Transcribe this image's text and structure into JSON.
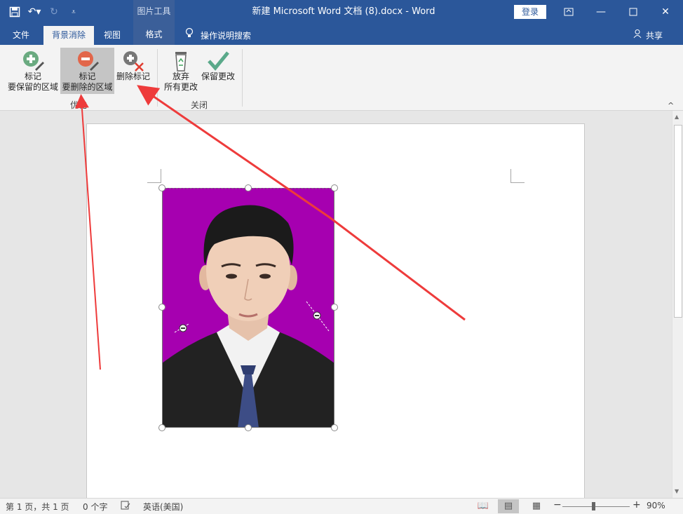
{
  "titlebar": {
    "context_group": "图片工具",
    "doc_title": "新建 Microsoft Word 文档 (8).docx  -  Word",
    "login": "登录",
    "icons": [
      "save-icon",
      "undo-icon",
      "redo-icon",
      "customize-qat-icon",
      "ribbon-display-icon",
      "minimize-icon",
      "maximize-icon",
      "close-icon"
    ]
  },
  "tabs": {
    "file": "文件",
    "bg_removal": "背景消除",
    "view": "视图",
    "format": "格式",
    "search": "操作说明搜索",
    "share": "共享"
  },
  "ribbon": {
    "mark_keep": [
      "标记",
      "要保留的区域"
    ],
    "mark_remove": [
      "标记",
      "要删除的区域"
    ],
    "delete_mark": "删除标记",
    "discard": [
      "放弃",
      "所有更改"
    ],
    "keep_changes": "保留更改",
    "group_refine": "优化",
    "group_close": "关闭"
  },
  "status": {
    "page": "第 1 页，共 1 页",
    "words": "0 个字",
    "language": "英语(美国)",
    "zoom": "90%"
  },
  "colors": {
    "accent": "#2b579a",
    "photo_background": "#a600b0",
    "arrow": "#ee3b3b"
  }
}
